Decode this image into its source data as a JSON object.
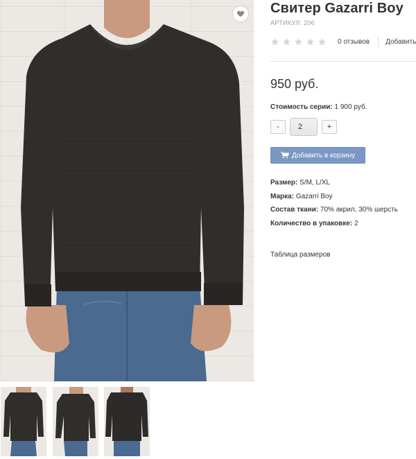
{
  "product": {
    "title": "Свитер Gazarri Boy",
    "sku_label": "Артикул:",
    "sku_value": "206",
    "rating_stars": 0,
    "rating_max": 5,
    "reviews_text": "0 отзывов",
    "add_review_text": "Добавить",
    "price": "950 руб.",
    "series_label": "Стоимость серии:",
    "series_value": "1 900 руб.",
    "quantity": "2",
    "qty_minus": "-",
    "qty_plus": "+",
    "add_to_cart": "Добавить в корзину",
    "properties": [
      {
        "label": "Размер:",
        "value": "S/M, L/XL"
      },
      {
        "label": "Марка:",
        "value": "Gazarri Boy"
      },
      {
        "label": "Состав ткани:",
        "value": "70% акрил, 30% шерсть"
      },
      {
        "label": "Количество в упаковке:",
        "value": "2"
      }
    ],
    "size_table_link": "Таблица размеров"
  },
  "icons": {
    "wishlist": "heart-icon",
    "cart": "cart-icon",
    "star": "star-icon"
  },
  "colors": {
    "accent_button": "#7b98c5",
    "sweater": "#2f2e2b",
    "jeans": "#4a6a8f",
    "star_empty": "#d6d6d6"
  }
}
